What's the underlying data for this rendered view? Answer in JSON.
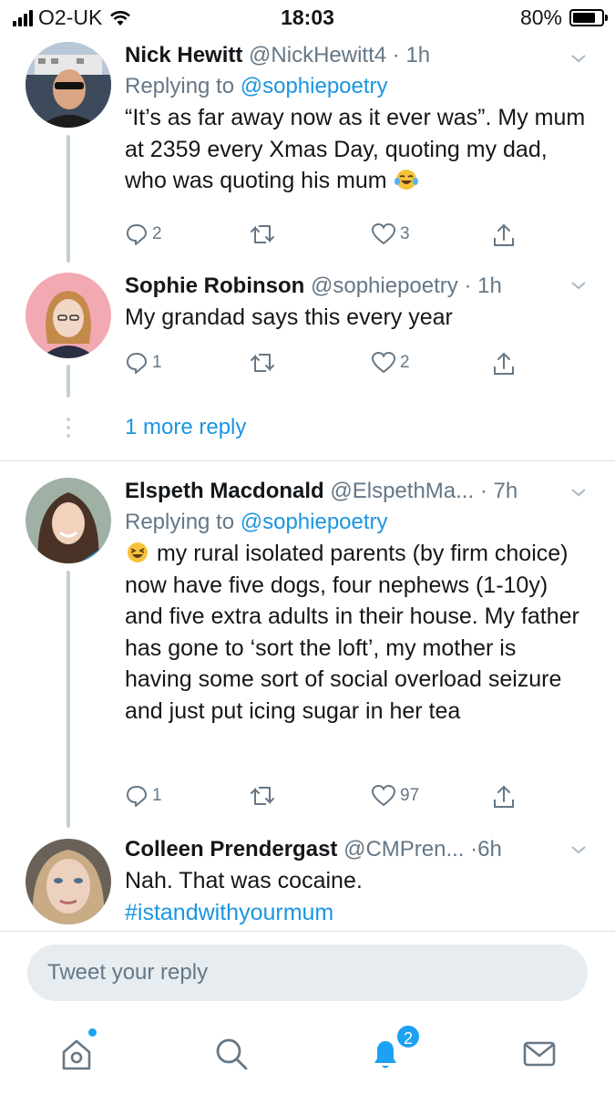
{
  "status_bar": {
    "carrier": "O2-UK",
    "time": "18:03",
    "battery": "80%",
    "battery_level": 0.8
  },
  "tweets": [
    {
      "name": "Nick Hewitt",
      "handle": "@NickHewitt4",
      "time": "· 1h",
      "replying_prefix": "Replying to ",
      "replying_to": "@sophiepoetry",
      "text": "“It’s as far away now as it ever was”. My mum at 2359 every Xmas Day, quoting my dad, who was quoting his mum",
      "emoji": "tears-of-joy-emoji",
      "replies": "2",
      "retweets": "",
      "likes": "3"
    },
    {
      "name": "Sophie Robinson",
      "handle": "@sophiepoetry",
      "time": "· 1h",
      "text": "My grandad says this every year",
      "replies": "1",
      "retweets": "",
      "likes": "2"
    },
    {
      "name": "Elspeth Macdonald",
      "handle": "@ElspethMa...",
      "time": "· 7h",
      "replying_prefix": "Replying to ",
      "replying_to": "@sophiepoetry",
      "emoji": "laughing-emoji",
      "text": "my rural isolated parents (by firm choice) now have five dogs, four nephews (1-10y) and five extra adults in their house. My father has gone to ‘sort the loft’, my mother is having some sort of social overload seizure and just put icing sugar in her tea",
      "replies": "1",
      "retweets": "",
      "likes": "97"
    },
    {
      "name": "Colleen Prendergast",
      "handle": "@CMPren...",
      "time": "·6h",
      "text": "Nah. That was cocaine.",
      "hashtag": "#istandwithyourmum"
    }
  ],
  "more_replies": "1 more reply",
  "reply_placeholder": "Tweet your reply",
  "nav": {
    "items": [
      "home-icon",
      "search-icon",
      "notifications-icon",
      "messages-icon"
    ],
    "notification_count": "2"
  },
  "colors": {
    "accent": "#1da1f2",
    "link": "#1b95e0",
    "muted": "#657786",
    "thread": "#c4cfd6"
  }
}
